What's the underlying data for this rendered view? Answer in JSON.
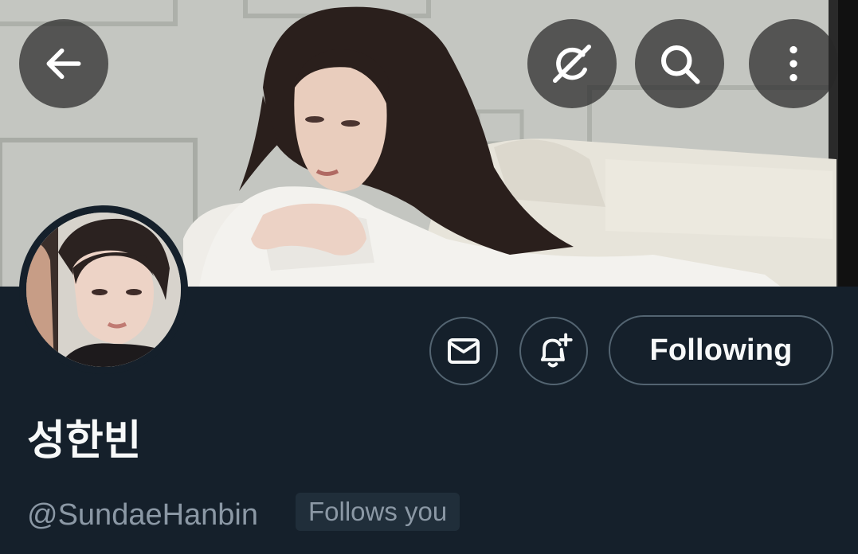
{
  "profile": {
    "display_name": "성한빈",
    "handle": "@SundaeHanbin",
    "follows_you": "Follows you"
  },
  "actions": {
    "following_label": "Following"
  },
  "icons": {
    "back": "arrow-left-icon",
    "grok": "grok-icon",
    "search": "search-icon",
    "more": "more-vertical-icon",
    "message": "mail-icon",
    "notify": "bell-plus-icon"
  },
  "colors": {
    "background": "#15202b",
    "text_primary": "#f7f9f9",
    "text_secondary": "#8b98a5",
    "border": "#536471"
  }
}
